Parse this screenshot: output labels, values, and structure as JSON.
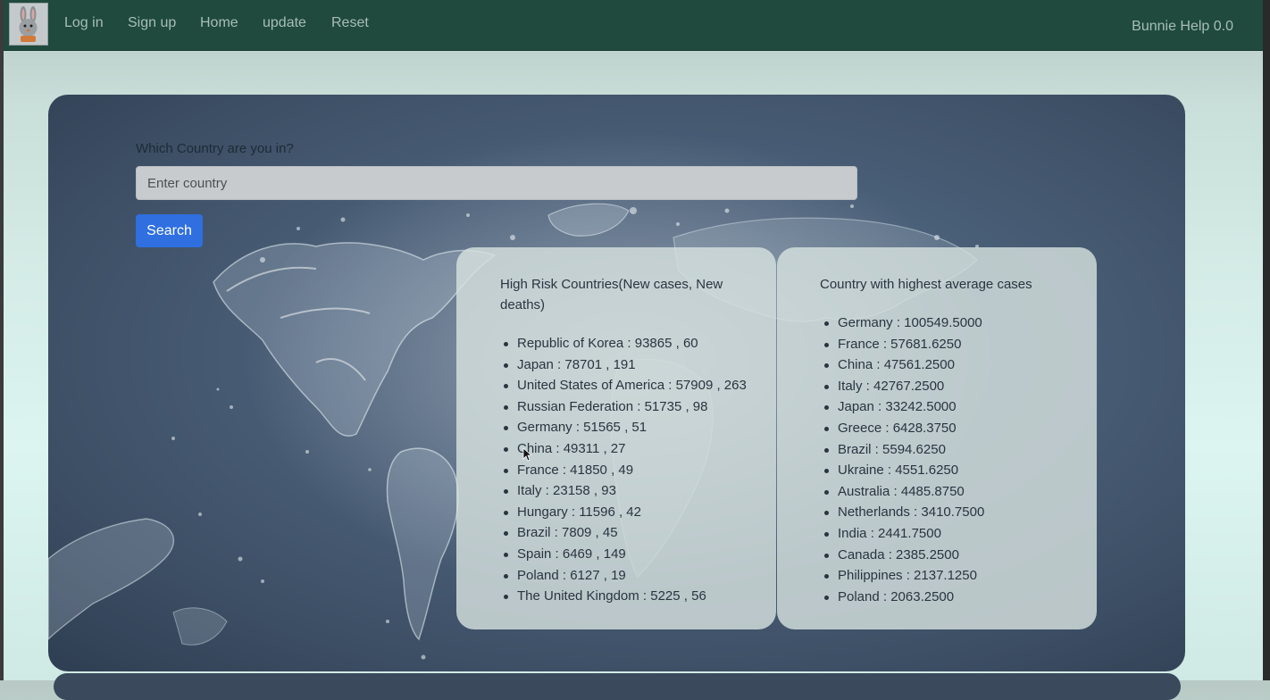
{
  "navbar": {
    "logo_icon": "bunny-logo-icon",
    "links": [
      {
        "label": "Log in"
      },
      {
        "label": "Sign up"
      },
      {
        "label": "Home"
      },
      {
        "label": "update"
      },
      {
        "label": "Reset"
      }
    ],
    "brand_right": "Bunnie Help 0.0"
  },
  "search": {
    "label": "Which Country are you in?",
    "placeholder": "Enter country",
    "value": "",
    "button_label": "Search",
    "button_color": "#2f6fe0"
  },
  "high_risk": {
    "title": "High Risk Countries(New cases, New deaths)",
    "items": [
      "Republic of Korea : 93865 , 60",
      "Japan : 78701 , 191",
      "United States of America : 57909 , 263",
      "Russian Federation : 51735 , 98",
      "Germany : 51565 , 51",
      "China : 49311 , 27",
      "France : 41850 , 49",
      "Italy : 23158 , 93",
      "Hungary : 11596 , 42",
      "Brazil : 7809 , 45",
      "Spain : 6469 , 149",
      "Poland : 6127 , 19",
      "The United Kingdom : 5225 , 56"
    ]
  },
  "highest_average": {
    "title": "Country with highest average cases",
    "items": [
      "Germany : 100549.5000",
      "France : 57681.6250",
      "China : 47561.2500",
      "Italy : 42767.2500",
      "Japan : 33242.5000",
      "Greece : 6428.3750",
      "Brazil : 5594.6250",
      "Ukraine : 4551.6250",
      "Australia : 4485.8750",
      "Netherlands : 3410.7500",
      "India : 2441.7500",
      "Canada : 2385.2500",
      "Philippines : 2137.1250",
      "Poland : 2063.2500"
    ]
  },
  "colors": {
    "navbar": "#1f4a3d",
    "panel": "#4a5f78",
    "card": "#d6e0de"
  }
}
